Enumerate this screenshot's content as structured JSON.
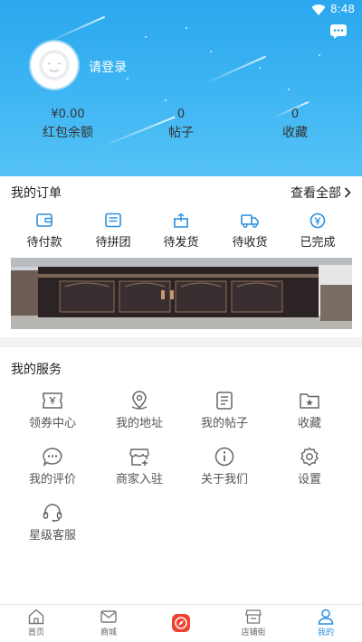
{
  "status_bar": {
    "time": "8:48"
  },
  "header": {
    "login_text": "请登录",
    "stats": [
      {
        "value": "¥0.00",
        "label": "红包余额"
      },
      {
        "value": "0",
        "label": "帖子"
      },
      {
        "value": "0",
        "label": "收藏"
      }
    ]
  },
  "orders": {
    "title": "我的订单",
    "see_all": "查看全部",
    "items": [
      {
        "label": "待付款",
        "icon": "wallet-icon"
      },
      {
        "label": "待拼团",
        "icon": "group-list-icon"
      },
      {
        "label": "待发货",
        "icon": "package-icon"
      },
      {
        "label": "待收货",
        "icon": "truck-icon"
      },
      {
        "label": "已完成",
        "icon": "yen-check-icon"
      }
    ]
  },
  "services": {
    "title": "我的服务",
    "items": [
      {
        "label": "领券中心",
        "icon": "coupon-icon"
      },
      {
        "label": "我的地址",
        "icon": "location-icon"
      },
      {
        "label": "我的帖子",
        "icon": "posts-icon"
      },
      {
        "label": "收藏",
        "icon": "folder-star-icon"
      },
      {
        "label": "我的评价",
        "icon": "comment-icon"
      },
      {
        "label": "商家入驻",
        "icon": "store-plus-icon"
      },
      {
        "label": "关于我们",
        "icon": "info-icon"
      },
      {
        "label": "设置",
        "icon": "gear-icon"
      },
      {
        "label": "星级客服",
        "icon": "headset-icon"
      }
    ]
  },
  "bottom_nav": [
    {
      "label": "首页",
      "icon": "home-icon"
    },
    {
      "label": "商城",
      "icon": "mail-icon"
    },
    {
      "label": "",
      "icon": "compass-icon"
    },
    {
      "label": "店铺街",
      "icon": "shop-icon"
    },
    {
      "label": "我的",
      "icon": "user-icon"
    }
  ],
  "colors": {
    "header_start": "#2aa7ee",
    "header_end": "#56c3f6",
    "accent_blue": "#2a8fe0",
    "compass_red": "#f0412f"
  }
}
